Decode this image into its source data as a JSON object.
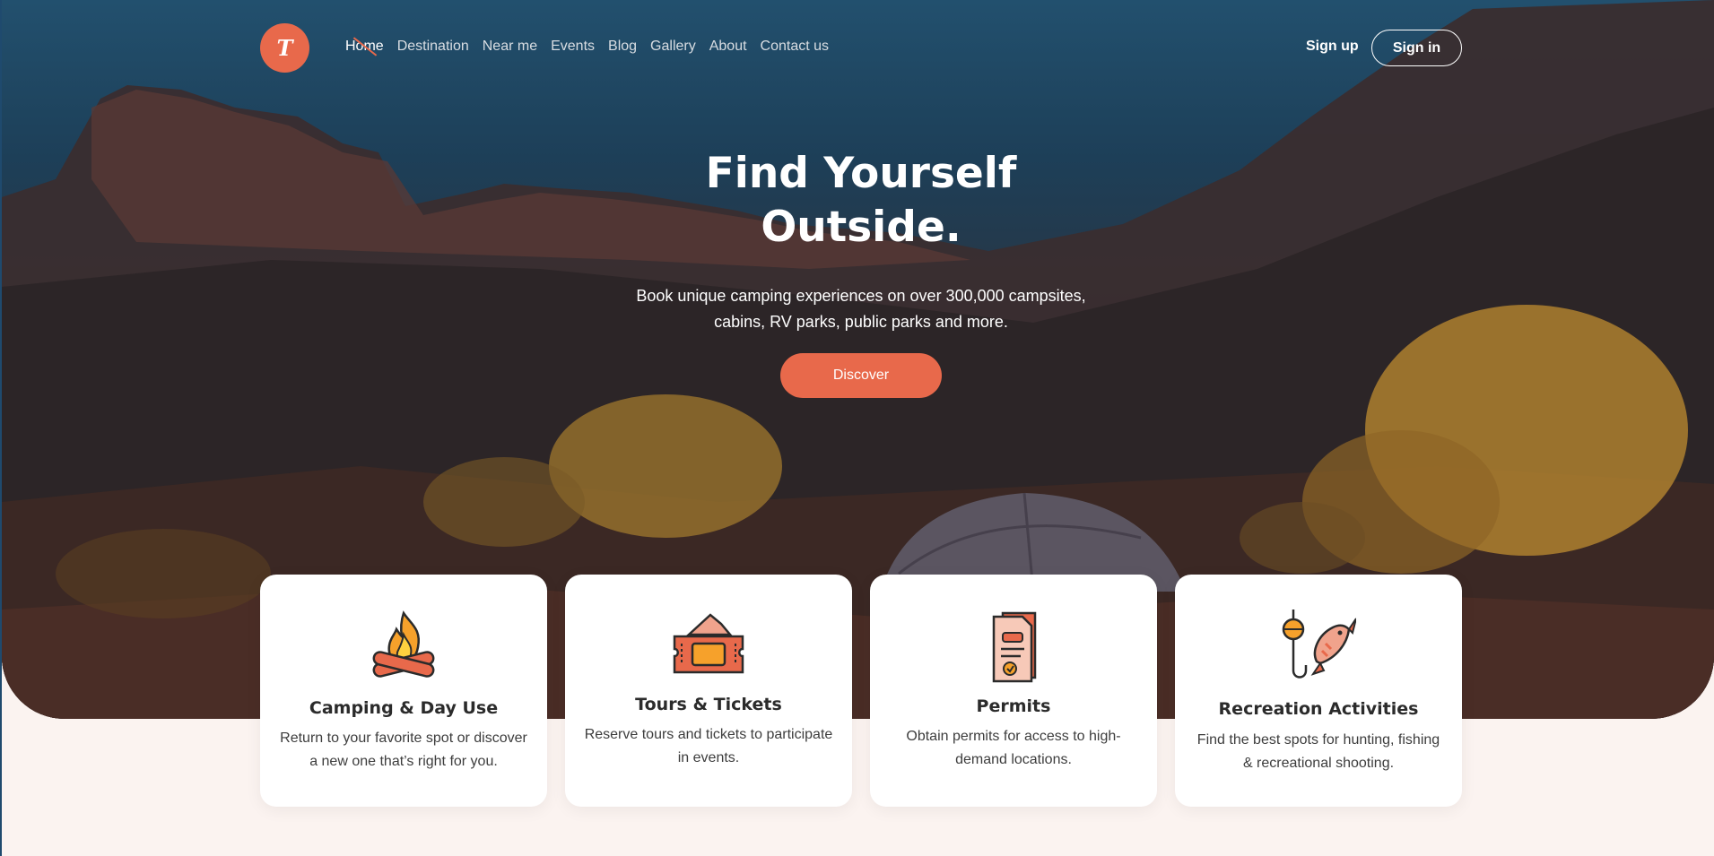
{
  "brand": {
    "logo_letter": "T",
    "accent": "#e8694b"
  },
  "nav": {
    "items": [
      {
        "label": "Home",
        "active": true
      },
      {
        "label": "Destination"
      },
      {
        "label": "Near me"
      },
      {
        "label": "Events"
      },
      {
        "label": "Blog"
      },
      {
        "label": "Gallery"
      },
      {
        "label": "About"
      },
      {
        "label": "Contact us"
      }
    ],
    "signup_label": "Sign up",
    "signin_label": "Sign in"
  },
  "hero": {
    "headline_line1": "Find Yourself",
    "headline_line2": "Outside.",
    "sub_line1": "Book unique camping experiences on over 300,000 campsites,",
    "sub_line2": "cabins, RV parks, public parks and more.",
    "cta_label": "Discover"
  },
  "cards": [
    {
      "icon": "campfire-icon",
      "title": "Camping & Day Use",
      "desc_line1": "Return to your favorite spot or discover",
      "desc_line2": "a new one that’s right for you."
    },
    {
      "icon": "tickets-icon",
      "title": "Tours & Tickets",
      "desc_line1": "Reserve tours and tickets to participate",
      "desc_line2": "in events."
    },
    {
      "icon": "permit-document-icon",
      "title": "Permits",
      "desc_line1": "Obtain permits for access to high-",
      "desc_line2": "demand locations."
    },
    {
      "icon": "fishing-icon",
      "title": "Recreation Activities",
      "desc_line1": "Find the best spots for hunting, fishing",
      "desc_line2": "& recreational shooting."
    }
  ]
}
